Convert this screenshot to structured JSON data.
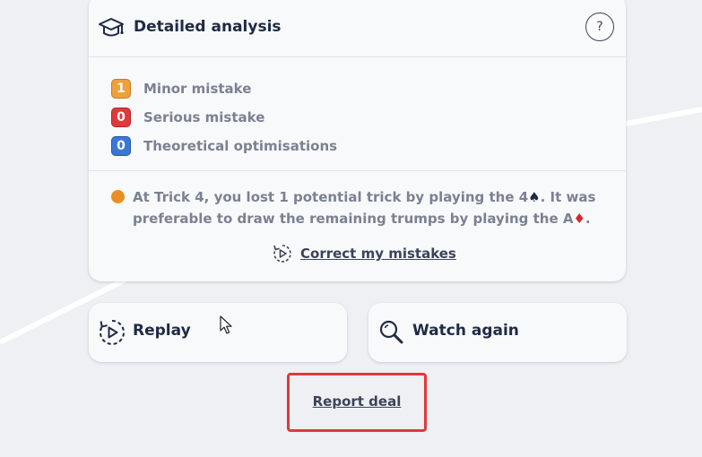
{
  "analysis": {
    "title": "Detailed analysis",
    "help_label": "?",
    "icon": "graduation-cap-icon",
    "legend": [
      {
        "count": "1",
        "label": "Minor mistake",
        "color": "#f0a03a"
      },
      {
        "count": "0",
        "label": "Serious mistake",
        "color": "#e0393b"
      },
      {
        "count": "0",
        "label": "Theoretical optimisations",
        "color": "#3a78d8"
      }
    ],
    "mistake": {
      "dot_color": "#e98f22",
      "part1": "At Trick 4, you lost 1 potential trick by playing the 4",
      "suit1": "♠",
      "part2": ". It was preferable to draw the remaining trumps by playing the A",
      "suit2": "♦",
      "part3": "."
    },
    "correct_label": "Correct my mistakes"
  },
  "actions": {
    "replay_label": "Replay",
    "watch_again_label": "Watch again"
  },
  "report_label": "Report deal",
  "colors": {
    "highlight_border": "#e0393b",
    "primary_text": "#1f2a44",
    "muted_text": "#7b8192"
  }
}
